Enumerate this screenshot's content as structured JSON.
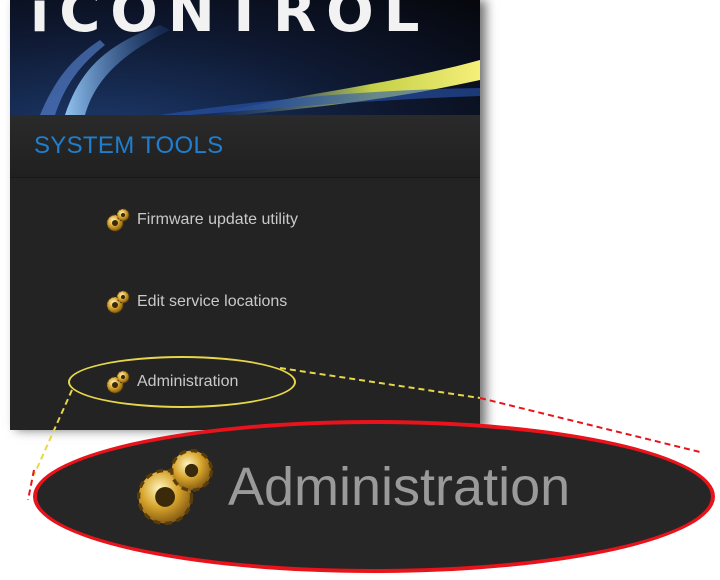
{
  "banner": {
    "title": "iCONTROL"
  },
  "section": {
    "title": "SYSTEM TOOLS"
  },
  "menu": {
    "items": [
      {
        "label": "Firmware update utility",
        "icon": "gears-icon"
      },
      {
        "label": "Edit service locations",
        "icon": "gears-icon"
      },
      {
        "label": "Administration",
        "icon": "gears-icon"
      }
    ]
  },
  "zoom": {
    "label": "Administration",
    "icon": "gears-icon"
  },
  "colors": {
    "panel_bg": "#232323",
    "section_title": "#1e7fd0",
    "highlight": "#e6d64a",
    "callout_border": "#e8131b"
  }
}
